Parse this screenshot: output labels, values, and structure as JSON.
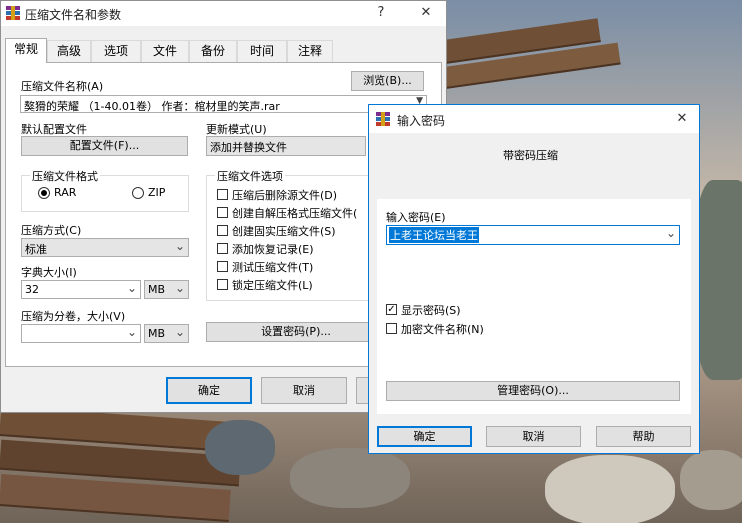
{
  "main_dialog": {
    "title": "压缩文件名和参数",
    "help_btn": "?",
    "close_btn": "✕",
    "tabs": [
      "常规",
      "高级",
      "选项",
      "文件",
      "备份",
      "时间",
      "注释"
    ],
    "archive_name_label": "压缩文件名称(A)",
    "browse_button": "浏览(B)...",
    "archive_name_value": "獒猾的荣耀 （1-40.01卷） 作者：棺材里的笑声.rar",
    "default_profile_label": "默认配置文件",
    "profiles_button": "配置文件(F)...",
    "update_mode_label": "更新模式(U)",
    "update_mode_value": "添加并替换文件",
    "format_group_title": "压缩文件格式",
    "format_options": [
      "RAR",
      "ZIP"
    ],
    "format_selected": "RAR",
    "compression_method_label": "压缩方式(C)",
    "compression_method_value": "标准",
    "dictionary_size_label": "字典大小(I)",
    "dictionary_size_value": "32",
    "dictionary_unit": "MB",
    "split_label": "压缩为分卷，大小(V)",
    "split_value": "",
    "split_unit": "MB",
    "options_group_title": "压缩文件选项",
    "options": [
      {
        "label": "压缩后删除源文件(D)",
        "checked": false
      },
      {
        "label": "创建自解压格式压缩文件(",
        "checked": false
      },
      {
        "label": "创建固实压缩文件(S)",
        "checked": false
      },
      {
        "label": "添加恢复记录(E)",
        "checked": false
      },
      {
        "label": "测试压缩文件(T)",
        "checked": false
      },
      {
        "label": "锁定压缩文件(L)",
        "checked": false
      }
    ],
    "set_password_button": "设置密码(P)...",
    "ok_button": "确定",
    "cancel_button": "取消"
  },
  "password_dialog": {
    "title": "输入密码",
    "close_btn": "✕",
    "heading": "带密码压缩",
    "enter_password_label": "输入密码(E)",
    "password_value": "上老王论坛当老王",
    "show_password_label": "显示密码(S)",
    "show_password_checked": true,
    "encrypt_names_label": "加密文件名称(N)",
    "encrypt_names_checked": false,
    "organize_button": "管理密码(O)...",
    "ok_button": "确定",
    "cancel_button": "取消",
    "help_button": "帮助"
  },
  "colors": {
    "accent": "#0078d7",
    "selection": "#0078d7",
    "dialog_bg": "#f0f0f0"
  }
}
